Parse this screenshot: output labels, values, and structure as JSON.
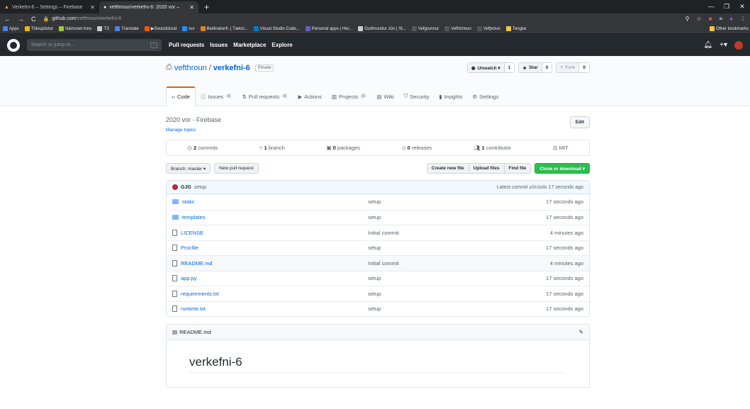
{
  "browser": {
    "tabs": [
      {
        "title": "Verkefni-6 – Settings – Firebase"
      },
      {
        "title": "vefthroun/verkefni-6: 2020 vor – "
      }
    ],
    "url_host": "github.com",
    "url_path": "/vefthroun/verkefni-6",
    "bookmarks": [
      "Apps",
      "Tölvupóstur",
      "Námsnet Innu",
      "TS",
      "Translate",
      "▶Soundcloud",
      "ruv",
      "Beiðnakerfi. | Tækni...",
      "Visual Studio Code...",
      "Personal apps | Her...",
      "Guðmundur Jón | St...",
      "Vefgrunnur",
      "Vefhönnun",
      "Vefþróun",
      "Tenglar"
    ],
    "other_bookmarks": "Other bookmarks"
  },
  "gh": {
    "search_placeholder": "Search or jump to...",
    "search_key": "/",
    "nav": [
      "Pull requests",
      "Issues",
      "Marketplace",
      "Explore"
    ]
  },
  "repo": {
    "owner": "vefthroun",
    "sep": "/",
    "name": "verkefni-6",
    "visibility": "Private",
    "unwatch_label": "Unwatch ▾",
    "unwatch_count": "1",
    "star_label": "Star",
    "star_count": "0",
    "fork_label": "Fork",
    "fork_count": "0",
    "tabs": [
      {
        "label": "Code",
        "count": ""
      },
      {
        "label": "Issues",
        "count": "0"
      },
      {
        "label": "Pull requests",
        "count": "0"
      },
      {
        "label": "Actions",
        "count": ""
      },
      {
        "label": "Projects",
        "count": "0"
      },
      {
        "label": "Wiki",
        "count": ""
      },
      {
        "label": "Security",
        "count": ""
      },
      {
        "label": "Insights",
        "count": ""
      },
      {
        "label": "Settings",
        "count": ""
      }
    ],
    "description": "2020 vor - Firebase",
    "manage_topics": "Manage topics",
    "edit": "Edit",
    "numbers": {
      "commits_n": "2",
      "commits": "commits",
      "branch_n": "1",
      "branch": "branch",
      "packages_n": "0",
      "packages": "packages",
      "releases_n": "0",
      "releases": "releases",
      "contrib_n": "1",
      "contrib": "contributor",
      "license": "MIT"
    },
    "branch_btn": "Branch: master ▾",
    "new_pr": "New pull request",
    "create_file": "Create new file",
    "upload": "Upload files",
    "find": "Find file",
    "clone": "Clone or download ▾",
    "commit": {
      "author": "GJG",
      "message": "setup",
      "latest": "Latest commit",
      "sha": "a561b8b",
      "time": "17 seconds ago"
    },
    "files": [
      {
        "type": "dir",
        "name": "static",
        "msg": "setup",
        "age": "17 seconds ago"
      },
      {
        "type": "dir",
        "name": "templates",
        "msg": "setup",
        "age": "17 seconds ago"
      },
      {
        "type": "file",
        "name": "LICENSE",
        "msg": "Initial commit",
        "age": "4 minutes ago"
      },
      {
        "type": "file",
        "name": "Procfile",
        "msg": "setup",
        "age": "17 seconds ago"
      },
      {
        "type": "file",
        "name": "README.md",
        "msg": "Initial commit",
        "age": "4 minutes ago"
      },
      {
        "type": "file",
        "name": "app.py",
        "msg": "setup",
        "age": "17 seconds ago"
      },
      {
        "type": "file",
        "name": "requirements.txt",
        "msg": "setup",
        "age": "17 seconds ago"
      },
      {
        "type": "file",
        "name": "runtime.txt",
        "msg": "setup",
        "age": "17 seconds ago"
      }
    ],
    "readme_file": "README.md",
    "readme_h1": "verkefni-6"
  }
}
